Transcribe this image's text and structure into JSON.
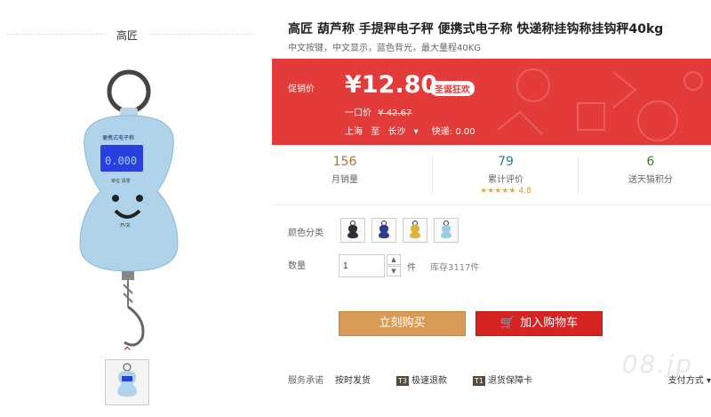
{
  "brand": "高匠",
  "product": {
    "title": "高匠 葫芦称 手提秤电子秤 便携式电子称 快递称挂钩称挂钩秤40kg",
    "subtitle": "中文按键，中文显示，蓝色背光，最大量程40KG"
  },
  "promo": {
    "label": "促销价",
    "price": "¥12.80",
    "tag": "圣诞狂欢",
    "orig_label": "一口价",
    "orig_price": "¥ 42.67",
    "ship_from": "上海",
    "ship_to_label": "至",
    "ship_to": "长沙",
    "express": "快递: 0.00",
    "accent": "#e33a3a"
  },
  "stats": [
    {
      "num": "156",
      "label": "月销量"
    },
    {
      "num": "79",
      "label": "累计评价",
      "stars": "★★★★★",
      "score": "4.8"
    },
    {
      "num": "6",
      "label": "送天猫积分"
    }
  ],
  "color_label": "颜色分类",
  "quantity": {
    "label": "数量",
    "value": "1",
    "unit": "件",
    "stock": "库存3117件"
  },
  "buttons": {
    "buy": "立刻购买",
    "cart": "加入购物车"
  },
  "service": {
    "label": "服务承诺",
    "items": [
      {
        "badge": "",
        "text": "按时发货"
      },
      {
        "badge": "T3",
        "text": "极速退款"
      },
      {
        "badge": "T1",
        "text": "退货保障卡"
      }
    ],
    "pay": "支付方式"
  },
  "watermark": "08.jp"
}
